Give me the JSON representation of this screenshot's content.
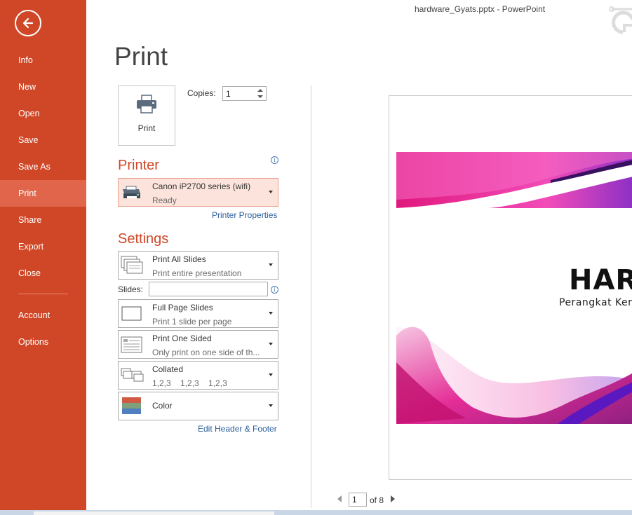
{
  "window": {
    "title": "hardware_Gyats.pptx - PowerPoint"
  },
  "sidebar": {
    "back_label": "Back",
    "items": [
      {
        "label": "Info"
      },
      {
        "label": "New"
      },
      {
        "label": "Open"
      },
      {
        "label": "Save"
      },
      {
        "label": "Save As"
      },
      {
        "label": "Print",
        "active": true
      },
      {
        "label": "Share"
      },
      {
        "label": "Export"
      },
      {
        "label": "Close"
      },
      {
        "label": "Account"
      },
      {
        "label": "Options"
      }
    ]
  },
  "main": {
    "title": "Print",
    "print_button": "Print",
    "copies": {
      "label": "Copies:",
      "value": "1"
    },
    "printer": {
      "heading": "Printer",
      "name": "Canon iP2700 series (wifi)",
      "status": "Ready",
      "properties_link": "Printer Properties"
    },
    "settings": {
      "heading": "Settings",
      "range": {
        "title": "Print All Slides",
        "subtitle": "Print entire presentation"
      },
      "slides_label": "Slides:",
      "slides_value": "",
      "layout": {
        "title": "Full Page Slides",
        "subtitle": "Print 1 slide per page"
      },
      "sides": {
        "title": "Print One Sided",
        "subtitle": "Only print on one side of th..."
      },
      "collation": {
        "title": "Collated",
        "subtitle": "1,2,3    1,2,3    1,2,3"
      },
      "color": {
        "title": "Color"
      },
      "header_footer_link": "Edit Header & Footer"
    }
  },
  "preview": {
    "slide_title": "HARD",
    "slide_subtitle": "Perangkat Kera",
    "page_current": "1",
    "page_total_text": "of 8"
  },
  "colors": {
    "sidebar_bg": "#D04727",
    "sidebar_active": "#E0654A",
    "accent_heading": "#D04727",
    "link": "#2A5E9A",
    "printer_selected_bg": "#FCE4DC"
  }
}
